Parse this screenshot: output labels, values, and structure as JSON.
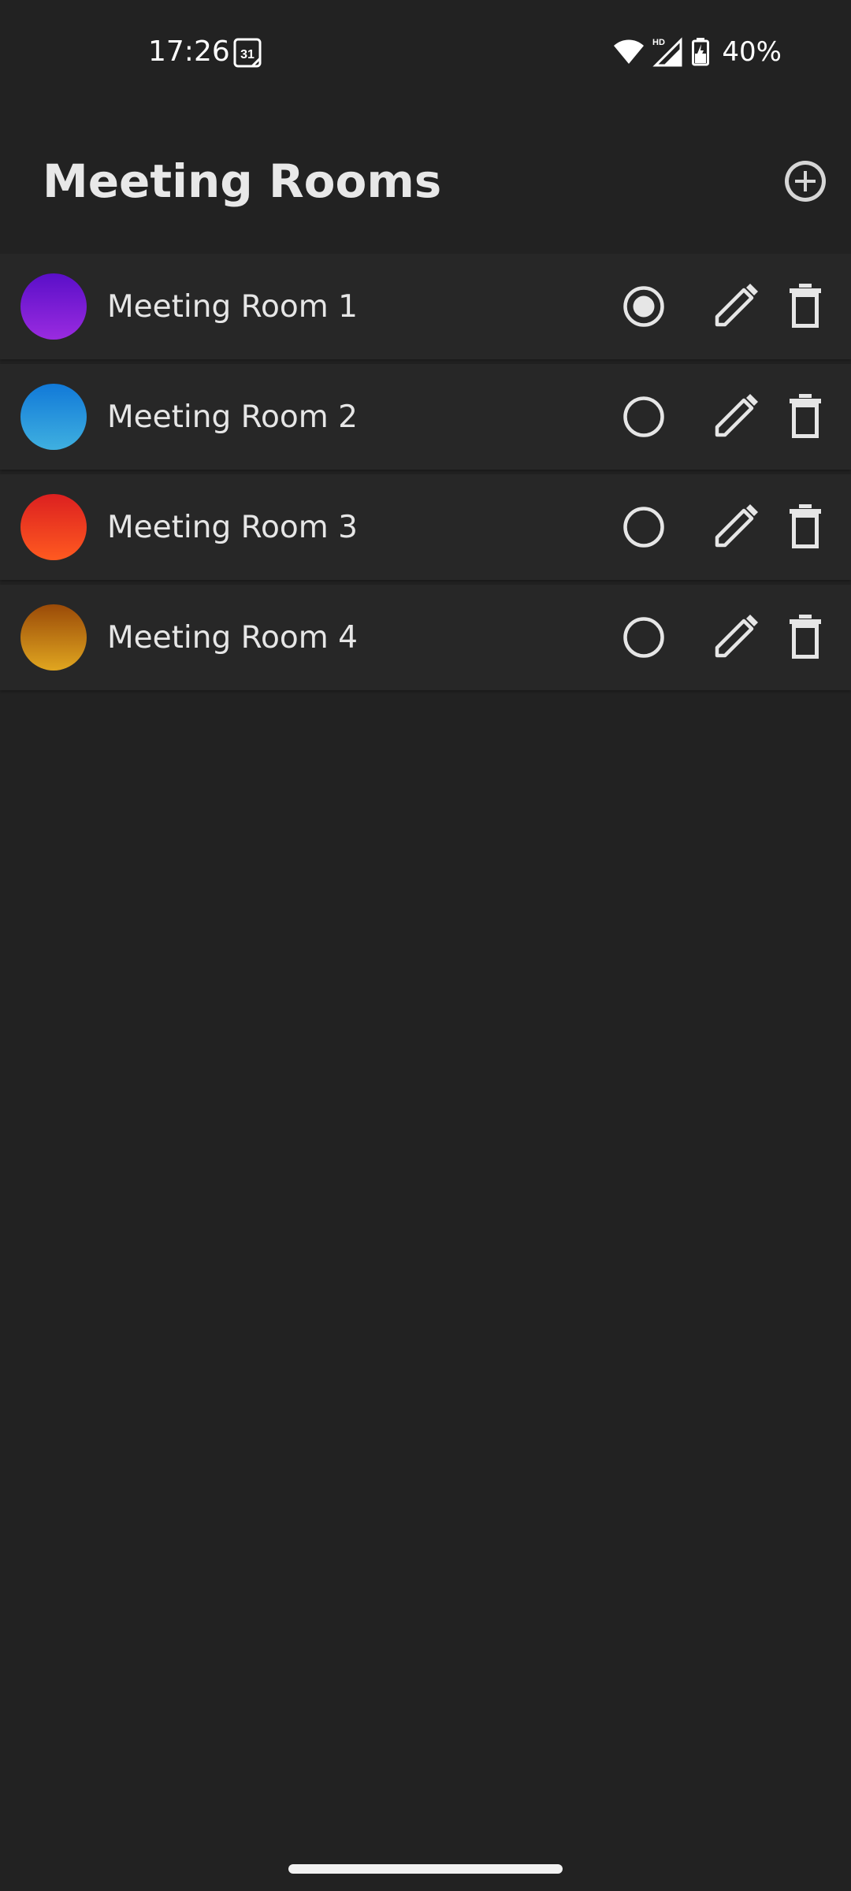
{
  "status_bar": {
    "time": "17:26",
    "calendar_day": "31",
    "network_badge": "HD",
    "battery_percent": "40%"
  },
  "header": {
    "title": "Meeting Rooms",
    "add_icon": "add-circle-icon"
  },
  "rooms": [
    {
      "name": "Meeting Room 1",
      "selected": true,
      "gradient": [
        "#5a0fc8",
        "#9a2be0"
      ]
    },
    {
      "name": "Meeting Room 2",
      "selected": false,
      "gradient": [
        "#1179d8",
        "#3fb0e0"
      ]
    },
    {
      "name": "Meeting Room 3",
      "selected": false,
      "gradient": [
        "#dc2020",
        "#ff5a20"
      ]
    },
    {
      "name": "Meeting Room 4",
      "selected": false,
      "gradient": [
        "#9a4a08",
        "#e0a620"
      ]
    }
  ],
  "colors": {
    "background": "#222222",
    "row_background": "#272727",
    "icon": "#e6e6e6"
  }
}
